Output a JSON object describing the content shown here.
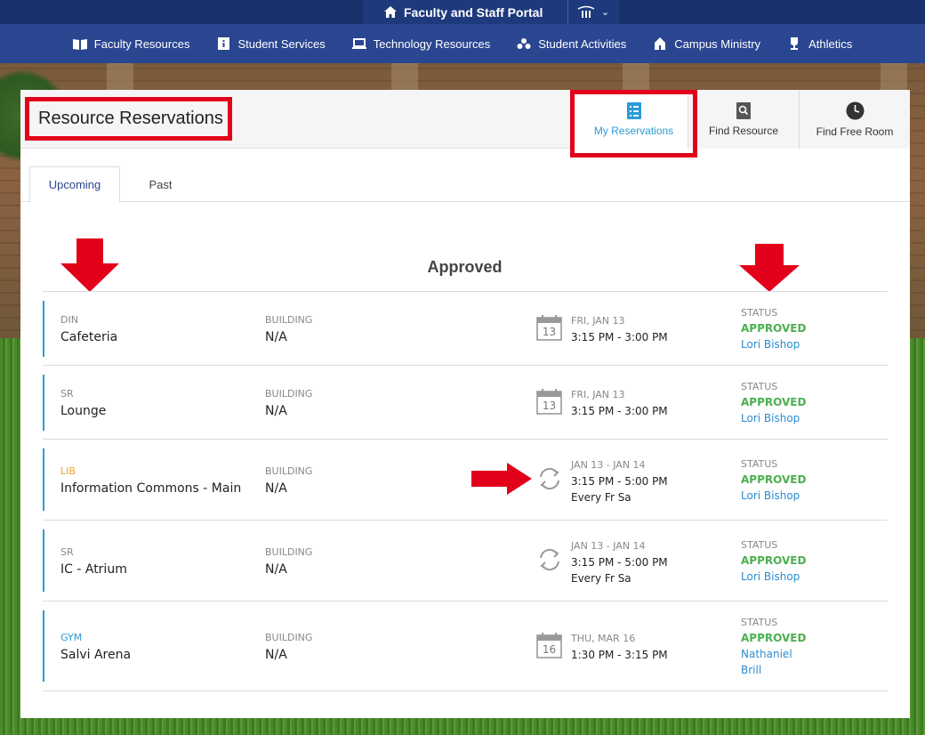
{
  "portal": {
    "title": "Faculty and Staff Portal"
  },
  "nav": {
    "items": [
      {
        "label": "Faculty Resources",
        "icon": "book-icon"
      },
      {
        "label": "Student Services",
        "icon": "info-icon"
      },
      {
        "label": "Technology Resources",
        "icon": "laptop-icon"
      },
      {
        "label": "Student Activities",
        "icon": "people-icon"
      },
      {
        "label": "Campus Ministry",
        "icon": "chapel-icon"
      },
      {
        "label": "Athletics",
        "icon": "trophy-icon"
      }
    ]
  },
  "page": {
    "title": "Resource Reservations",
    "header_buttons": [
      {
        "label": "My Reservations",
        "icon": "checklist-icon",
        "active": true
      },
      {
        "label": "Find Resource",
        "icon": "search-icon",
        "active": false
      },
      {
        "label": "Find Free Room",
        "icon": "clock-icon",
        "active": false
      }
    ],
    "tabs": [
      {
        "label": "Upcoming",
        "active": true
      },
      {
        "label": "Past",
        "active": false
      }
    ],
    "section_title": "Approved",
    "building_label": "BUILDING",
    "status_label": "STATUS"
  },
  "reservations": [
    {
      "code": "DIN",
      "code_color": "#888888",
      "name": "Cafeteria",
      "building": "N/A",
      "icon": "calendar-icon",
      "icon_day": "13",
      "date": "FRI, JAN 13",
      "time": "3:15 PM - 3:00 PM",
      "repeat": "",
      "status": "APPROVED",
      "person_lines": [
        "Lori Bishop"
      ]
    },
    {
      "code": "SR",
      "code_color": "#888888",
      "name": "Lounge",
      "building": "N/A",
      "icon": "calendar-icon",
      "icon_day": "13",
      "date": "FRI, JAN 13",
      "time": "3:15 PM - 3:00 PM",
      "repeat": "",
      "status": "APPROVED",
      "person_lines": [
        "Lori Bishop"
      ]
    },
    {
      "code": "LIB",
      "code_color": "#e8a321",
      "name": "Information Commons - Main",
      "building": "N/A",
      "icon": "repeat-icon",
      "icon_day": "",
      "date": "JAN 13 - JAN 14",
      "time": "3:15 PM - 5:00 PM",
      "repeat": "Every Fr Sa",
      "status": "APPROVED",
      "person_lines": [
        "Lori Bishop"
      ]
    },
    {
      "code": "SR",
      "code_color": "#888888",
      "name": "IC - Atrium",
      "building": "N/A",
      "icon": "repeat-icon",
      "icon_day": "",
      "date": "JAN 13 - JAN 14",
      "time": "3:15 PM - 5:00 PM",
      "repeat": "Every Fr Sa",
      "status": "APPROVED",
      "person_lines": [
        "Lori Bishop"
      ]
    },
    {
      "code": "GYM",
      "code_color": "#2c9bd6",
      "name": "Salvi Arena",
      "building": "N/A",
      "icon": "calendar-icon",
      "icon_day": "16",
      "date": "THU, MAR 16",
      "time": "1:30 PM - 3:15 PM",
      "repeat": "",
      "status": "APPROVED",
      "person_lines": [
        "Nathaniel",
        "Brill"
      ]
    }
  ],
  "colors": {
    "accent": "#2c9bd6",
    "approved": "#4caf50",
    "nav_bg": "#2b4691",
    "annotation_red": "#e2001a"
  }
}
